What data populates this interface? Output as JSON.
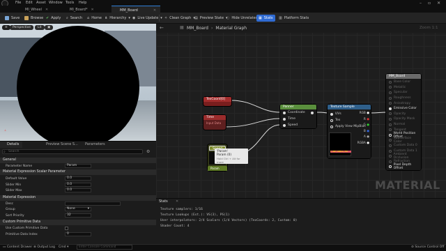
{
  "menu": [
    "File",
    "Edit",
    "Asset",
    "Window",
    "Tools",
    "Help"
  ],
  "doc_tabs": [
    {
      "label": "MI_Wheel",
      "active": false
    },
    {
      "label": "MI_Board",
      "modified": true,
      "active": false
    },
    {
      "label": "MM_Board",
      "active": true
    }
  ],
  "toolbar": {
    "save": "Save",
    "browse": "Browse",
    "apply": "Apply",
    "search": "Search",
    "home": "Home",
    "hierarchy": "Hierarchy",
    "live_update": "Live Update",
    "clean_graph": "Clean Graph",
    "preview_state": "Preview State",
    "hide_unrelated": "Hide Unrelated",
    "stats": "Stats",
    "platform_stats": "Platform Stats"
  },
  "viewport": {
    "perspective": "Perspective",
    "lit": "Lit"
  },
  "details": {
    "tabs": [
      "Details",
      "Preview Scene S...",
      "Parameters"
    ],
    "search_placeholder": "Search",
    "sections": {
      "general": "General",
      "scalar": "Material Expression Scalar Parameter",
      "material_expr": "Material Expression",
      "custom_prim": "Custom Primitive Data"
    },
    "props": {
      "parameter_name": {
        "label": "Parameter Name",
        "value": "Param"
      },
      "default_value": {
        "label": "Default Value",
        "value": "0.0"
      },
      "slider_min": {
        "label": "Slider Min",
        "value": "0.0"
      },
      "slider_max": {
        "label": "Slider Max",
        "value": "0.0"
      },
      "desc": {
        "label": "Desc"
      },
      "group": {
        "label": "Group",
        "value": "None"
      },
      "sort_priority": {
        "label": "Sort Priority",
        "value": "32"
      },
      "use_custom_primitive": {
        "label": "Use Custom Primitive Data"
      },
      "primitive_index": {
        "label": "Primitive Data Index",
        "value": "0"
      }
    }
  },
  "graph": {
    "breadcrumb_root": "MM_Board",
    "breadcrumb_leaf": "Material Graph",
    "zoom": "Zoom 1:1",
    "watermark": "MATERIAL",
    "nodes": {
      "texcoord": {
        "title": "TexCoord[0]"
      },
      "time": {
        "title": "Time",
        "subtitle": "Input Data"
      },
      "param": {
        "title": "Speed",
        "subtitle": "Param"
      },
      "panner": {
        "title": "Panner",
        "pins": [
          "Coordinate",
          "Time",
          "Speed"
        ]
      },
      "texture_sample": {
        "title": "Texture Sample",
        "inputs": [
          "UVs",
          "Tex",
          "Apply View MipBias"
        ],
        "outputs": [
          "RGB",
          "R",
          "G",
          "B",
          "A",
          "RGBA"
        ],
        "preview_label": "T_UINT_DEBUG_TEX"
      },
      "result": {
        "title": "MM_Board",
        "pins": [
          "Base Color",
          "Metallic",
          "Specular",
          "Roughness",
          "Anisotropy",
          "Emissive Color",
          "Opacity",
          "Opacity Mask",
          "Normal",
          "Tangent",
          "World Position Offset",
          "Subsurface Color",
          "Custom Data 0",
          "Custom Data 1",
          "Ambient Occlusion",
          "Refraction",
          "Pixel Depth Offset"
        ]
      }
    },
    "tooltip": {
      "line1": "'Param'",
      "line2": "Param (0)",
      "line3": "Hold Ctrl + Alt for more"
    }
  },
  "stats": {
    "tab": "Stats",
    "lines": [
      "Texture samplers: 1/16",
      "Texture Lookups (Est.): VS(3), PS(1)",
      "User interpolators: 2/4 Scalars (1/4 Vectors) (TexCoords: 2, Custom: 0)",
      "Shader Count: 4"
    ]
  },
  "statusbar": {
    "content_drawer": "Content Drawer",
    "output_log": "Output Log",
    "cmd": "Cmd",
    "cmd_placeholder": "Enter Console Command",
    "source_control": "Source Control Off"
  },
  "colors": {
    "accent": "#2f6bd3",
    "panner": "#5a8f3d",
    "texture": "#2f5f8a",
    "param_node": "#6e7d2c",
    "red_node": "#8a2424",
    "result": "#6a6a6a"
  }
}
